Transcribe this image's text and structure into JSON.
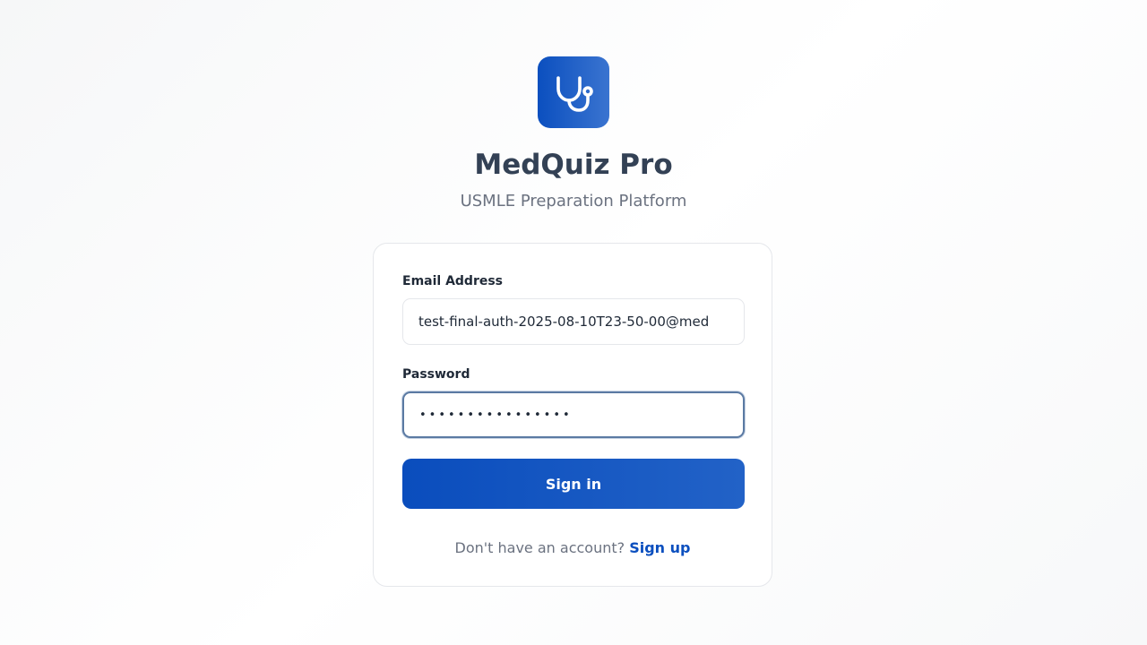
{
  "app": {
    "title": "MedQuiz Pro",
    "subtitle": "USMLE Preparation Platform",
    "logo_icon": "stethoscope-icon",
    "brand_color": "#0b4fbf"
  },
  "form": {
    "email_label": "Email Address",
    "email_value": "test-final-auth-2025-08-10T23-50-00@med",
    "password_label": "Password",
    "password_value": "••••••••••••••••",
    "submit_label": "Sign in"
  },
  "signup": {
    "prompt": "Don't have an account?",
    "link_label": "Sign up"
  }
}
